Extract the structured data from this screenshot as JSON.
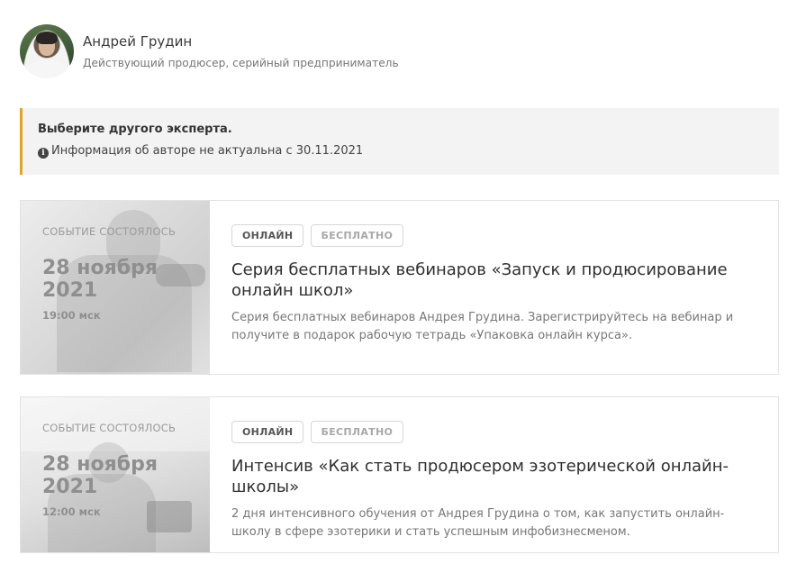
{
  "author": {
    "name": "Андрей Грудин",
    "role": "Действующий продюсер, серийный предприниматель"
  },
  "notice": {
    "title": "Выберите другого эксперта.",
    "info_icon": "info-circle-icon",
    "info_text": "Информация об авторе не актуальна с 30.11.2021",
    "accent_color": "#e2a51e"
  },
  "events": [
    {
      "status": "СОБЫТИЕ СОСТОЯЛОСЬ",
      "date": "28 ноября 2021",
      "time": "19:00 мск",
      "tags": [
        "ОНЛАЙН",
        "БЕСПЛАТНО"
      ],
      "title": "Серия бесплатных вебинаров «Запуск и продюсирование онлайн школ»",
      "description": "Серия бесплатных вебинаров Андрея Грудина. Зарегистрируйтесь на вебинар и получите в подарок рабочую тетрадь «Упаковка онлайн курса»."
    },
    {
      "status": "СОБЫТИЕ СОСТОЯЛОСЬ",
      "date": "28 ноября 2021",
      "time": "12:00 мск",
      "tags": [
        "ОНЛАЙН",
        "БЕСПЛАТНО"
      ],
      "title": "Интенсив «Как стать продюсером эзотерической онлайн-школы»",
      "description": "2 дня интенсивного обучения от Андрея Грудина о том, как запустить онлайн-школу в сфере эзотерики и стать успешным инфобизнесменом."
    }
  ]
}
